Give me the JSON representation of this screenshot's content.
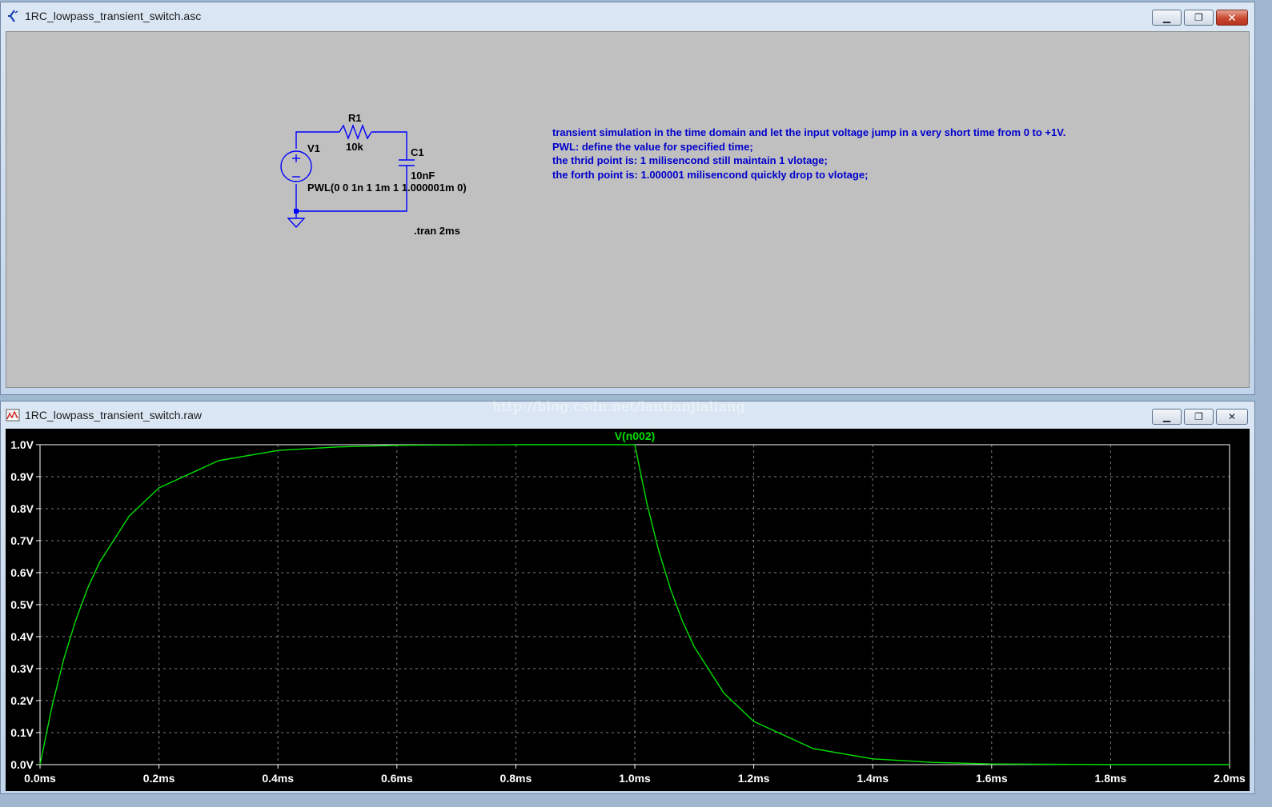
{
  "schematic_window": {
    "title": "1RC_lowpass_transient_switch.asc",
    "controls": {
      "minimize": "▁",
      "maximize": "❐",
      "close": "✕"
    },
    "components": {
      "resistor": {
        "name": "R1",
        "value": "10k"
      },
      "capacitor": {
        "name": "C1",
        "value": "10nF"
      },
      "source": {
        "name": "V1",
        "value": "PWL(0 0 1n 1 1m 1 1.000001m 0)"
      }
    },
    "directive": ".tran 2ms",
    "comments": [
      "transient simulation in the time domain and let the input voltage jump in a very short time from 0 to +1V.",
      "PWL: define the value for specified time;",
      "the thrid point is: 1 milisencond still maintain 1 vlotage;",
      "the forth point is: 1.000001 milisencond quickly drop to vlotage;"
    ],
    "colors": {
      "wire": "#0000ff",
      "text": "#000000",
      "comment": "#0000cc",
      "background": "#c0c0c0"
    }
  },
  "waveform_window": {
    "title": "1RC_lowpass_transient_switch.raw",
    "controls": {
      "minimize": "▁",
      "maximize": "❐",
      "close": "✕"
    },
    "watermark": "http://blog.csdn.net/lantianjialiang"
  },
  "chart_data": {
    "type": "line",
    "title": "V(n002)",
    "x_ticks": [
      "0.0ms",
      "0.2ms",
      "0.4ms",
      "0.6ms",
      "0.8ms",
      "1.0ms",
      "1.2ms",
      "1.4ms",
      "1.6ms",
      "1.8ms",
      "2.0ms"
    ],
    "y_ticks": [
      "0.0V",
      "0.1V",
      "0.2V",
      "0.3V",
      "0.4V",
      "0.5V",
      "0.6V",
      "0.7V",
      "0.8V",
      "0.9V",
      "1.0V"
    ],
    "xlim": [
      0,
      2.0
    ],
    "ylim": [
      0,
      1.0
    ],
    "x_unit": "ms",
    "y_unit": "V",
    "grid": true,
    "series": [
      {
        "name": "V(n002)",
        "color": "#00e000",
        "x": [
          0,
          0.02,
          0.04,
          0.06,
          0.08,
          0.1,
          0.15,
          0.2,
          0.3,
          0.4,
          0.5,
          0.6,
          0.8,
          1.0,
          1.02,
          1.04,
          1.06,
          1.08,
          1.1,
          1.15,
          1.2,
          1.3,
          1.4,
          1.5,
          1.6,
          1.8,
          2.0
        ],
        "y": [
          0,
          0.181,
          0.33,
          0.451,
          0.551,
          0.632,
          0.777,
          0.865,
          0.95,
          0.982,
          0.993,
          0.998,
          1.0,
          1.0,
          0.819,
          0.67,
          0.549,
          0.449,
          0.368,
          0.223,
          0.135,
          0.05,
          0.018,
          0.007,
          0.002,
          0.0,
          0.0
        ]
      }
    ],
    "colors": {
      "background": "#000000",
      "grid": "#7f7f7f",
      "axis_text": "#ffffff",
      "frame": "#ffffff"
    }
  }
}
